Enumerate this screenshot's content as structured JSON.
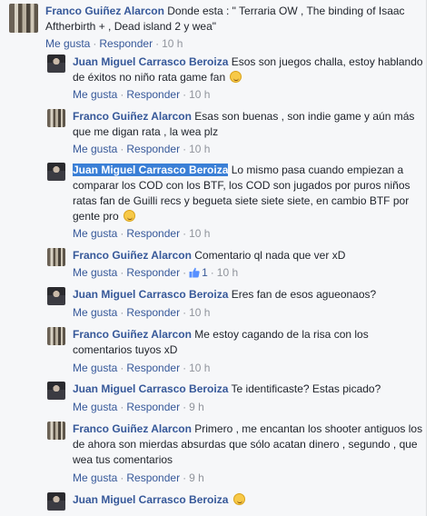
{
  "actions": {
    "like": "Me gusta",
    "reply": "Responder",
    "sep": "·"
  },
  "colors": {
    "link": "#365899",
    "meta": "#90949c",
    "highlight": "#3a7fd6"
  },
  "comments": [
    {
      "author": "Franco Guiñez Alarcon",
      "text": "Donde esta : \" Terraria OW , The binding of Isaac Aftherbirth + , Dead island 2 y wea\"",
      "time": "10 h",
      "avatar": "franco-avatar"
    },
    {
      "author": "Juan Miguel Carrasco Beroiza",
      "text": "Esos son juegos challa, estoy hablando de éxitos no niño rata game fan",
      "emoji": "smile-emoji",
      "time": "10 h",
      "avatar": "juan-avatar"
    },
    {
      "author": "Franco Guiñez Alarcon",
      "text": "Esas son buenas , son indie game y aún más que me digan rata , la wea plz",
      "time": "10 h",
      "avatar": "franco-avatar"
    },
    {
      "author": "Juan Miguel Carrasco Beroiza",
      "text": "Lo mismo pasa cuando empiezan a comparar los COD con los BTF, los COD son jugados por puros niños ratas fan de Guilli recs y begueta siete siete siete, en cambio BTF por gente pro",
      "emoji": "smile-emoji",
      "time": "10 h",
      "avatar": "juan-avatar",
      "highlighted": true
    },
    {
      "author": "Franco Guiñez Alarcon",
      "text": "Comentario ql nada que ver xD",
      "likes": "1",
      "time": "10 h",
      "avatar": "franco-avatar"
    },
    {
      "author": "Juan Miguel Carrasco Beroiza",
      "text": "Eres fan de esos agueonaos?",
      "time": "10 h",
      "avatar": "juan-avatar"
    },
    {
      "author": "Franco Guiñez Alarcon",
      "text": "Me estoy cagando de la risa con los comentarios tuyos xD",
      "time": "10 h",
      "avatar": "franco-avatar"
    },
    {
      "author": "Juan Miguel Carrasco Beroiza",
      "text": "Te identificaste? Estas picado?",
      "time": "9 h",
      "avatar": "juan-avatar"
    },
    {
      "author": "Franco Guiñez Alarcon",
      "text": "Primero , me encantan los shooter antiguos los de ahora son mierdas absurdas que sólo acatan dinero , segundo , que wea tus comentarios",
      "time": "9 h",
      "avatar": "franco-avatar"
    },
    {
      "author": "Juan Miguel Carrasco Beroiza",
      "text": "",
      "emoji": "smile-emoji",
      "avatar": "juan-avatar"
    }
  ]
}
